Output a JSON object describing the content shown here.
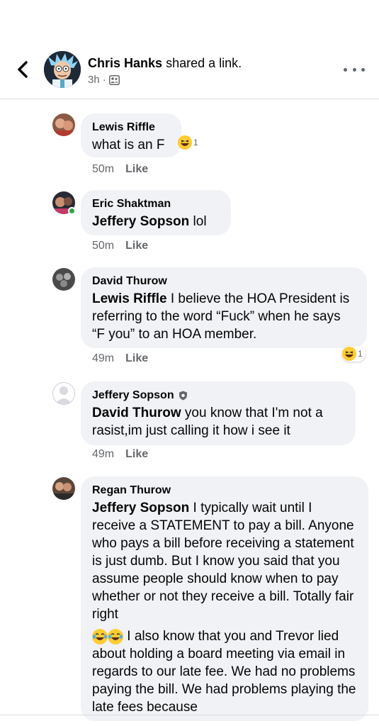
{
  "post": {
    "author": "Chris Hanks",
    "action": "shared a link.",
    "time": "3h",
    "dot": "·",
    "privacy_icon": "friends-icon"
  },
  "comments": [
    {
      "author": "Lewis Riffle",
      "mention": "",
      "text": "what is an F",
      "time": "50m",
      "like": "Like",
      "reaction_count": "1"
    },
    {
      "author": "Eric Shaktman",
      "mention": "Jeffery Sopson",
      "text": " lol",
      "time": "50m",
      "like": "Like"
    },
    {
      "author": "David Thurow",
      "mention": "Lewis Riffle",
      "text": " I believe the HOA President is referring to the word “Fuck” when he says “F you” to an HOA member.",
      "time": "49m",
      "like": "Like",
      "reaction_count": "1"
    },
    {
      "author": "Jeffery Sopson",
      "mention": "David Thurow",
      "text": " you know that I'm not a rasist,im just calling it how i see it",
      "time": "49m",
      "like": "Like"
    },
    {
      "author": "Regan Thurow",
      "mention": "Jeffery Sopson",
      "text": " I typically wait until I receive a STATEMENT to pay a bill. Anyone who pays a bill before receiving a statement is just dumb. But I know you said that you assume people should know when to pay whether or not they receive a bill. Totally fair right",
      "text2": " I also know that you and Trevor lied about holding a board meeting via email in regards to our late fee. We had no problems paying the bill. We had problems playing the late fees because"
    }
  ],
  "colors": {
    "bubble": "#f0f2f5",
    "meta": "#65676b",
    "online": "#31a24c",
    "emoji": "#ffcc33"
  }
}
